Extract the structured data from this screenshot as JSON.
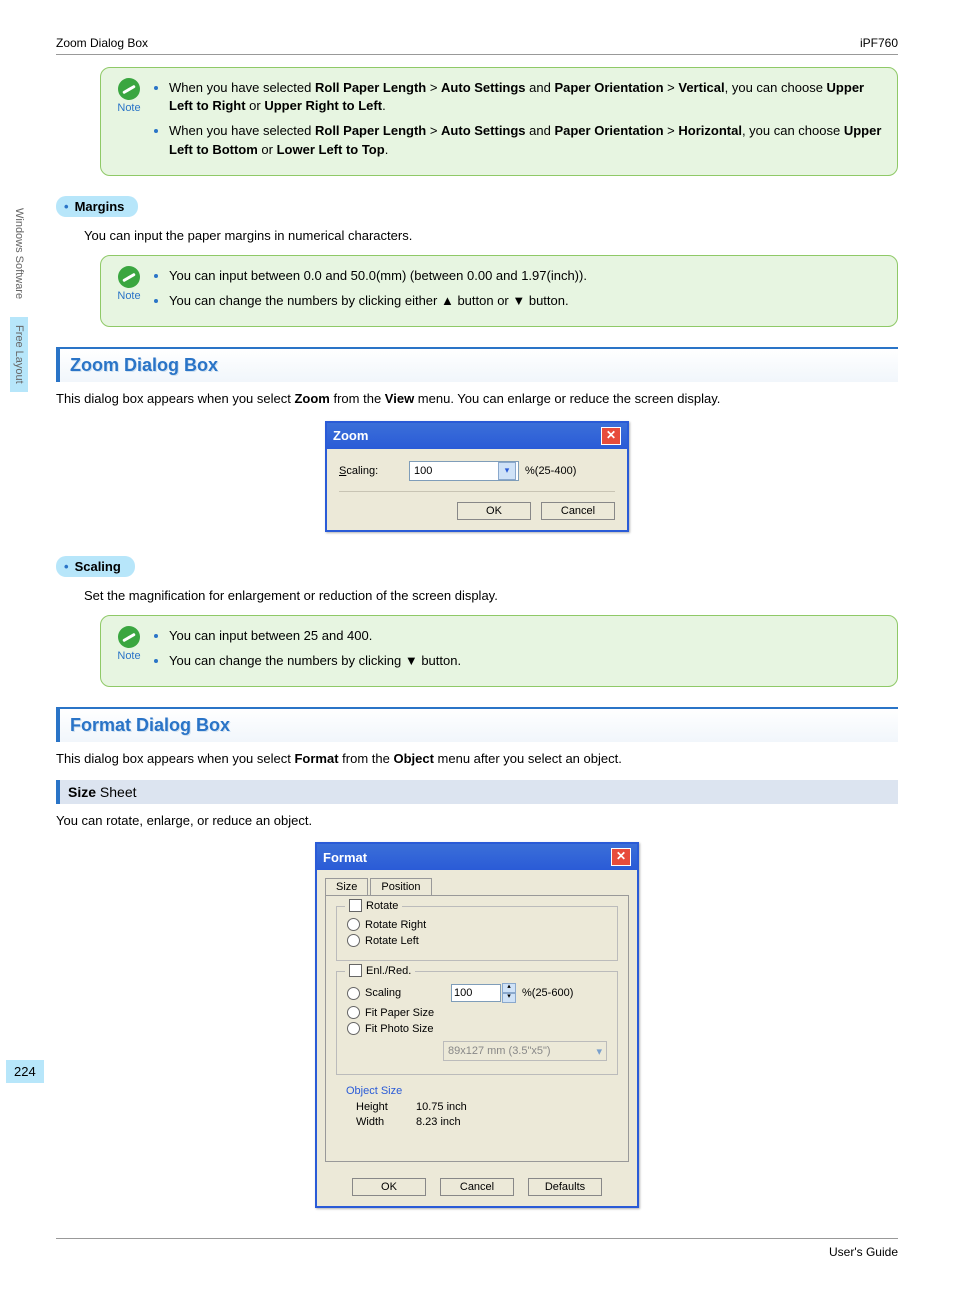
{
  "header": {
    "left": "Zoom Dialog Box",
    "right": "iPF760"
  },
  "sidebar": {
    "tab1": "Windows Software",
    "tab2": "Free Layout"
  },
  "note1": {
    "label": "Note",
    "b1a": "When you have selected ",
    "b1b": "Roll Paper Length",
    "b1c": " > ",
    "b1d": "Auto Settings",
    "b1e": " and ",
    "b1f": "Paper Orientation",
    "b1g": " > ",
    "b1h": "Vertical",
    "b1i": ", you can choose ",
    "b1j": "Upper Left to Right",
    "b1k": " or ",
    "b1l": "Upper Right to Left",
    "b1m": ".",
    "b2a": "When you have selected ",
    "b2b": "Roll Paper Length",
    "b2c": " > ",
    "b2d": "Auto Settings",
    "b2e": " and ",
    "b2f": "Paper Orientation",
    "b2g": " > ",
    "b2h": "Horizontal",
    "b2i": ", you can choose ",
    "b2j": "Upper Left to Bottom",
    "b2k": " or ",
    "b2l": "Lower Left to Top",
    "b2m": "."
  },
  "margins": {
    "heading": "Margins",
    "desc": "You can input the paper margins in numerical characters.",
    "noteLabel": "Note",
    "n1": "You can input between 0.0 and 50.0(mm) (between 0.00 and 1.97(inch)).",
    "n2": "You can change the numbers by clicking either ▲ button or ▼ button."
  },
  "zoomSection": {
    "heading": "Zoom Dialog Box",
    "d1": "This dialog box appears when you select ",
    "d2": "Zoom",
    "d3": " from the ",
    "d4": "View",
    "d5": " menu. You can enlarge or reduce the screen display."
  },
  "zoomDialog": {
    "title": "Zoom",
    "scalingLabel": "Scaling:",
    "value": "100",
    "range": "%(25-400)",
    "ok": "OK",
    "cancel": "Cancel"
  },
  "scaling": {
    "heading": "Scaling",
    "desc": "Set the magnification for enlargement or reduction of the screen display.",
    "noteLabel": "Note",
    "n1": "You can input between 25 and 400.",
    "n2": "You can change the numbers by clicking ▼ button."
  },
  "formatSection": {
    "heading": "Format Dialog Box",
    "d1": "This dialog box appears when you select ",
    "d2": "Format",
    "d3": " from the ",
    "d4": "Object",
    "d5": " menu after you select an object."
  },
  "sizeSheet": {
    "hb": "Size",
    "hr": " Sheet",
    "desc": "You can rotate, enlarge, or reduce an object."
  },
  "formatDialog": {
    "title": "Format",
    "tabSize": "Size",
    "tabPosition": "Position",
    "rotate": "Rotate",
    "rotateRight": "Rotate Right",
    "rotateLeft": "Rotate Left",
    "enlred": "Enl./Red.",
    "scaling": "Scaling",
    "scalingVal": "100",
    "scalingRange": "%(25-600)",
    "fitPaper": "Fit Paper Size",
    "fitPhoto": "Fit Photo Size",
    "photoSize": "89x127 mm (3.5\"x5\")",
    "objectSize": "Object Size",
    "heightLabel": "Height",
    "heightVal": "10.75 inch",
    "widthLabel": "Width",
    "widthVal": "8.23 inch",
    "ok": "OK",
    "cancel": "Cancel",
    "defaults": "Defaults"
  },
  "pageNumber": "224",
  "footer": "User's Guide"
}
